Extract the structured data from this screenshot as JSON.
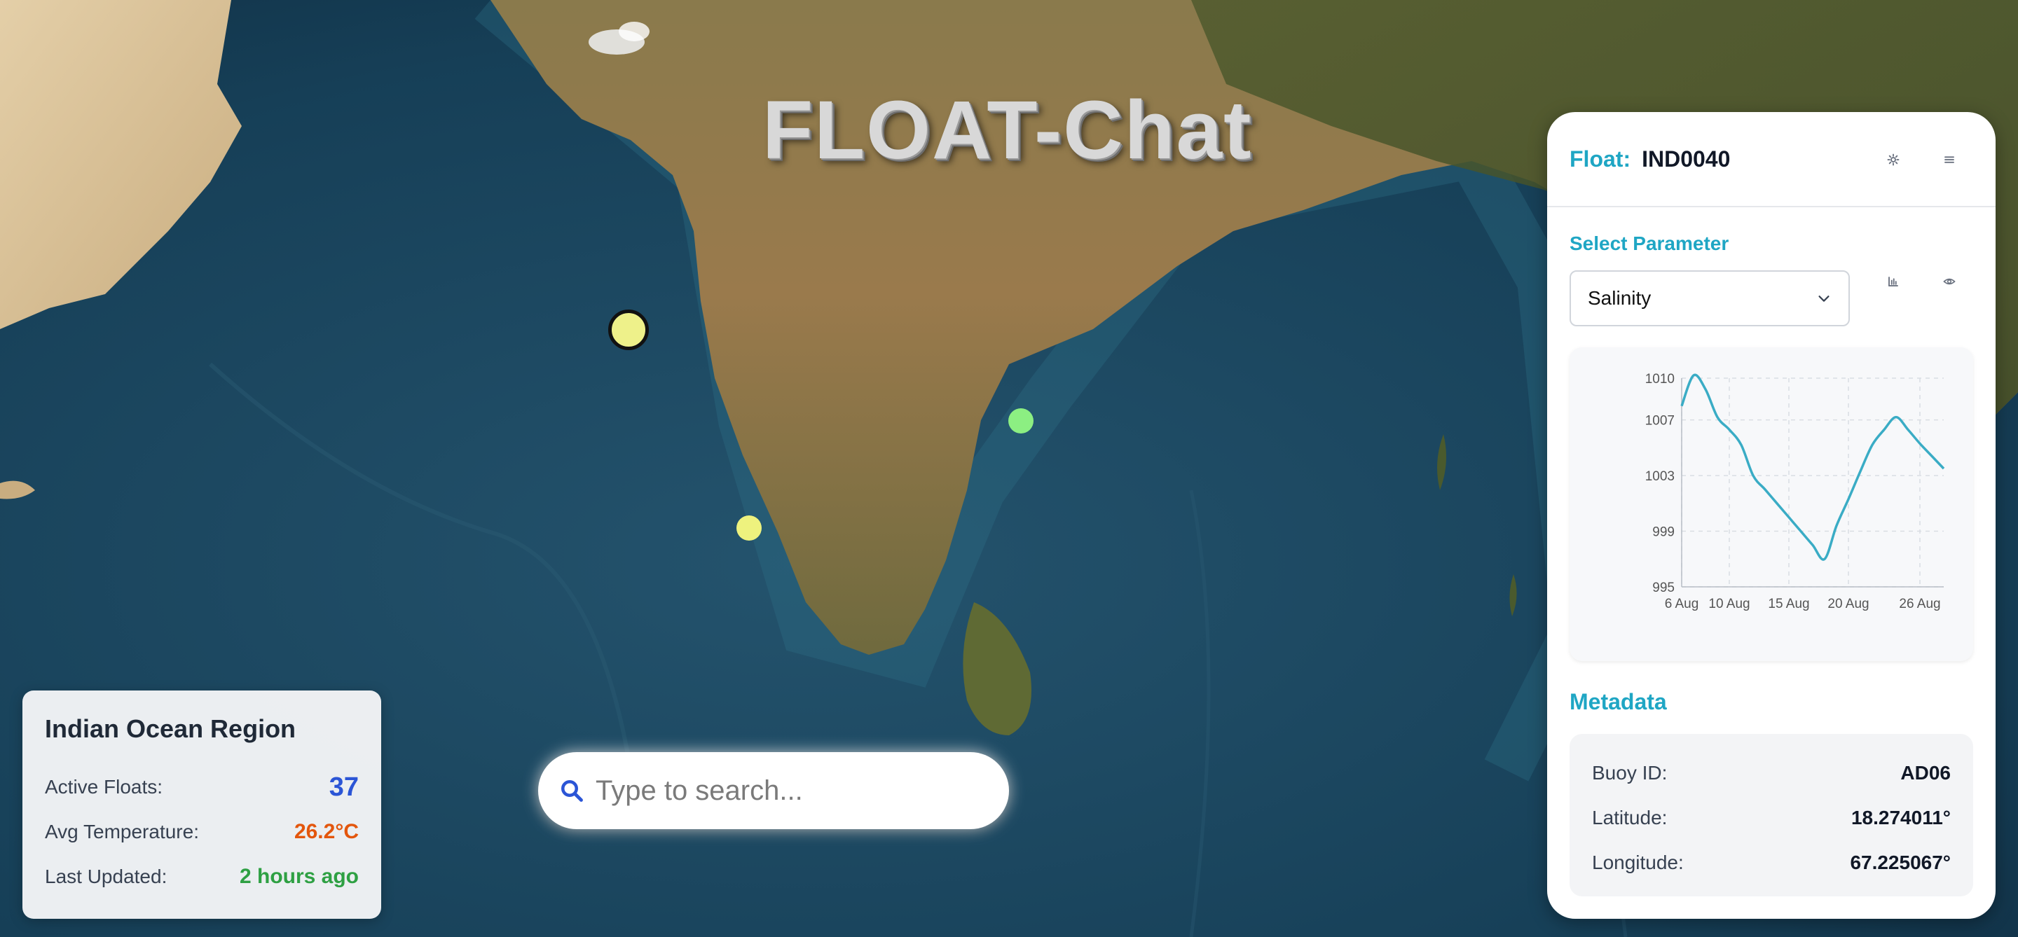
{
  "title": "FLOAT-Chat",
  "search": {
    "placeholder": "Type to search..."
  },
  "region": {
    "title": "Indian Ocean Region",
    "stats": [
      {
        "label": "Active Floats:",
        "value": "37",
        "color": "#2b55d6"
      },
      {
        "label": "Avg Temperature:",
        "value": "26.2°C",
        "color": "#e3560d"
      },
      {
        "label": "Last Updated:",
        "value": "2 hours ago",
        "color": "#2ea043"
      }
    ]
  },
  "map": {
    "markers": [
      {
        "name": "float-marker-selected",
        "color": "#eef18a",
        "selected": true
      },
      {
        "name": "float-marker-yellow",
        "color": "#eef27e",
        "selected": false
      },
      {
        "name": "float-marker-green",
        "color": "#8cef82",
        "selected": false
      }
    ]
  },
  "panel": {
    "float_prefix": "Float:",
    "float_id": "IND0040",
    "header_icons": [
      "settings-icon",
      "menu-icon"
    ],
    "select_label": "Select Parameter",
    "selected_parameter": "Salinity",
    "tool_icons": [
      "bar-chart-icon",
      "eye-icon"
    ],
    "metadata_title": "Metadata",
    "metadata": [
      {
        "label": "Buoy ID:",
        "value": "AD06"
      },
      {
        "label": "Latitude:",
        "value": "18.274011°"
      },
      {
        "label": "Longitude:",
        "value": "67.225067°"
      }
    ]
  },
  "chart_data": {
    "type": "line",
    "title": "",
    "xlabel": "",
    "ylabel": "",
    "x_ticks": [
      "6 Aug",
      "10 Aug",
      "15 Aug",
      "20 Aug",
      "26 Aug"
    ],
    "y_ticks": [
      995,
      999,
      1003,
      1007,
      1010
    ],
    "ylim": [
      995,
      1010
    ],
    "xlim": [
      "6 Aug",
      "28 Aug"
    ],
    "grid": true,
    "line_color": "#3aacc5",
    "x": [
      "6 Aug",
      "7 Aug",
      "8 Aug",
      "9 Aug",
      "10 Aug",
      "11 Aug",
      "12 Aug",
      "13 Aug",
      "14 Aug",
      "15 Aug",
      "16 Aug",
      "17 Aug",
      "18 Aug",
      "19 Aug",
      "20 Aug",
      "21 Aug",
      "22 Aug",
      "23 Aug",
      "24 Aug",
      "25 Aug",
      "26 Aug",
      "27 Aug",
      "28 Aug"
    ],
    "values": [
      1008.0,
      1010.2,
      1009.2,
      1007.2,
      1006.3,
      1005.2,
      1003.0,
      1002.0,
      1001.0,
      1000.0,
      999.0,
      998.0,
      997.0,
      999.4,
      1001.3,
      1003.3,
      1005.2,
      1006.3,
      1007.2,
      1006.3,
      1005.3,
      1004.4,
      1003.5
    ]
  }
}
